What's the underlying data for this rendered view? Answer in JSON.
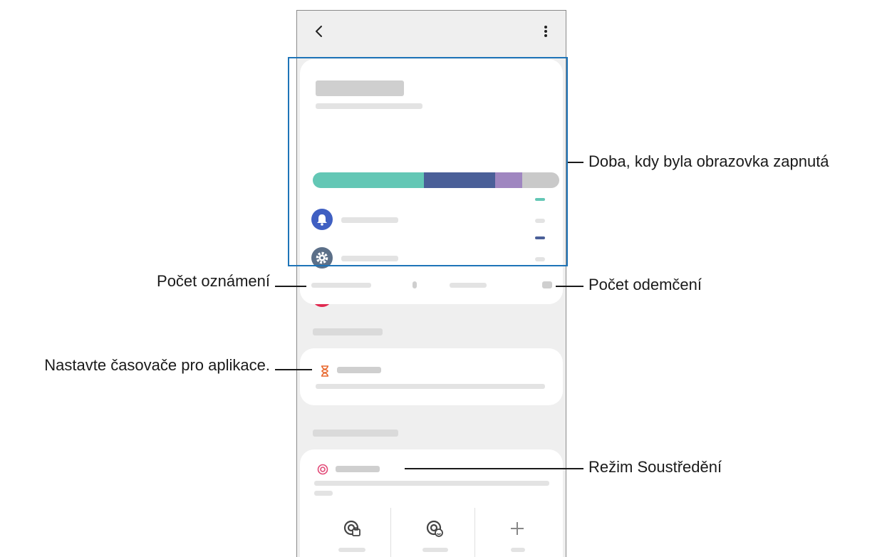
{
  "screen": {
    "header": {
      "back_icon": "chevron-left-icon",
      "more_icon": "more-vertical-icon"
    },
    "summary": {
      "title": "",
      "subtitle": "",
      "usage_bar": [
        {
          "color": "#63c7b5",
          "fraction": 0.45
        },
        {
          "color": "#4a5f98",
          "fraction": 0.29
        },
        {
          "color": "#9f86c0",
          "fraction": 0.11
        },
        {
          "color": "#c9c9c9",
          "fraction": 0.15
        }
      ]
    },
    "apps": [
      {
        "name": "",
        "icon": "bell-icon",
        "icon_color": "#3f5fc2",
        "accent": "#63c7b5",
        "time": ""
      },
      {
        "name": "",
        "icon": "gear-icon",
        "icon_color": "#5b6f88",
        "accent": "#4a5f98",
        "time": ""
      },
      {
        "name": "",
        "icon": "camera-icon",
        "icon_color": "#e0284f",
        "accent": "#9f86c0",
        "time": ""
      }
    ],
    "stats": {
      "notifications_label": "",
      "notifications_value": "",
      "unlocks_label": "",
      "unlocks_value": ""
    },
    "goals": {
      "section_label": "",
      "app_timers_title": "",
      "app_timers_desc": "",
      "icon": "hourglass-icon",
      "icon_color": "#e8672c"
    },
    "disconnect": {
      "section_label": "",
      "focus_mode_title": "",
      "focus_mode_desc": "",
      "icon": "target-icon",
      "icon_color": "#e24a78",
      "modes": [
        {
          "label": "",
          "icon": "work-mode-icon"
        },
        {
          "label": "",
          "icon": "relax-mode-icon"
        },
        {
          "label": "",
          "icon": "plus-icon"
        }
      ]
    }
  },
  "callouts": {
    "screen_time": "Doba, kdy byla obrazovka zapnutá",
    "notifications": "Počet oznámení",
    "unlocks": "Počet odemčení",
    "app_timers": "Nastavte časovače pro aplikace.",
    "focus_mode": "Režim Soustředění"
  }
}
